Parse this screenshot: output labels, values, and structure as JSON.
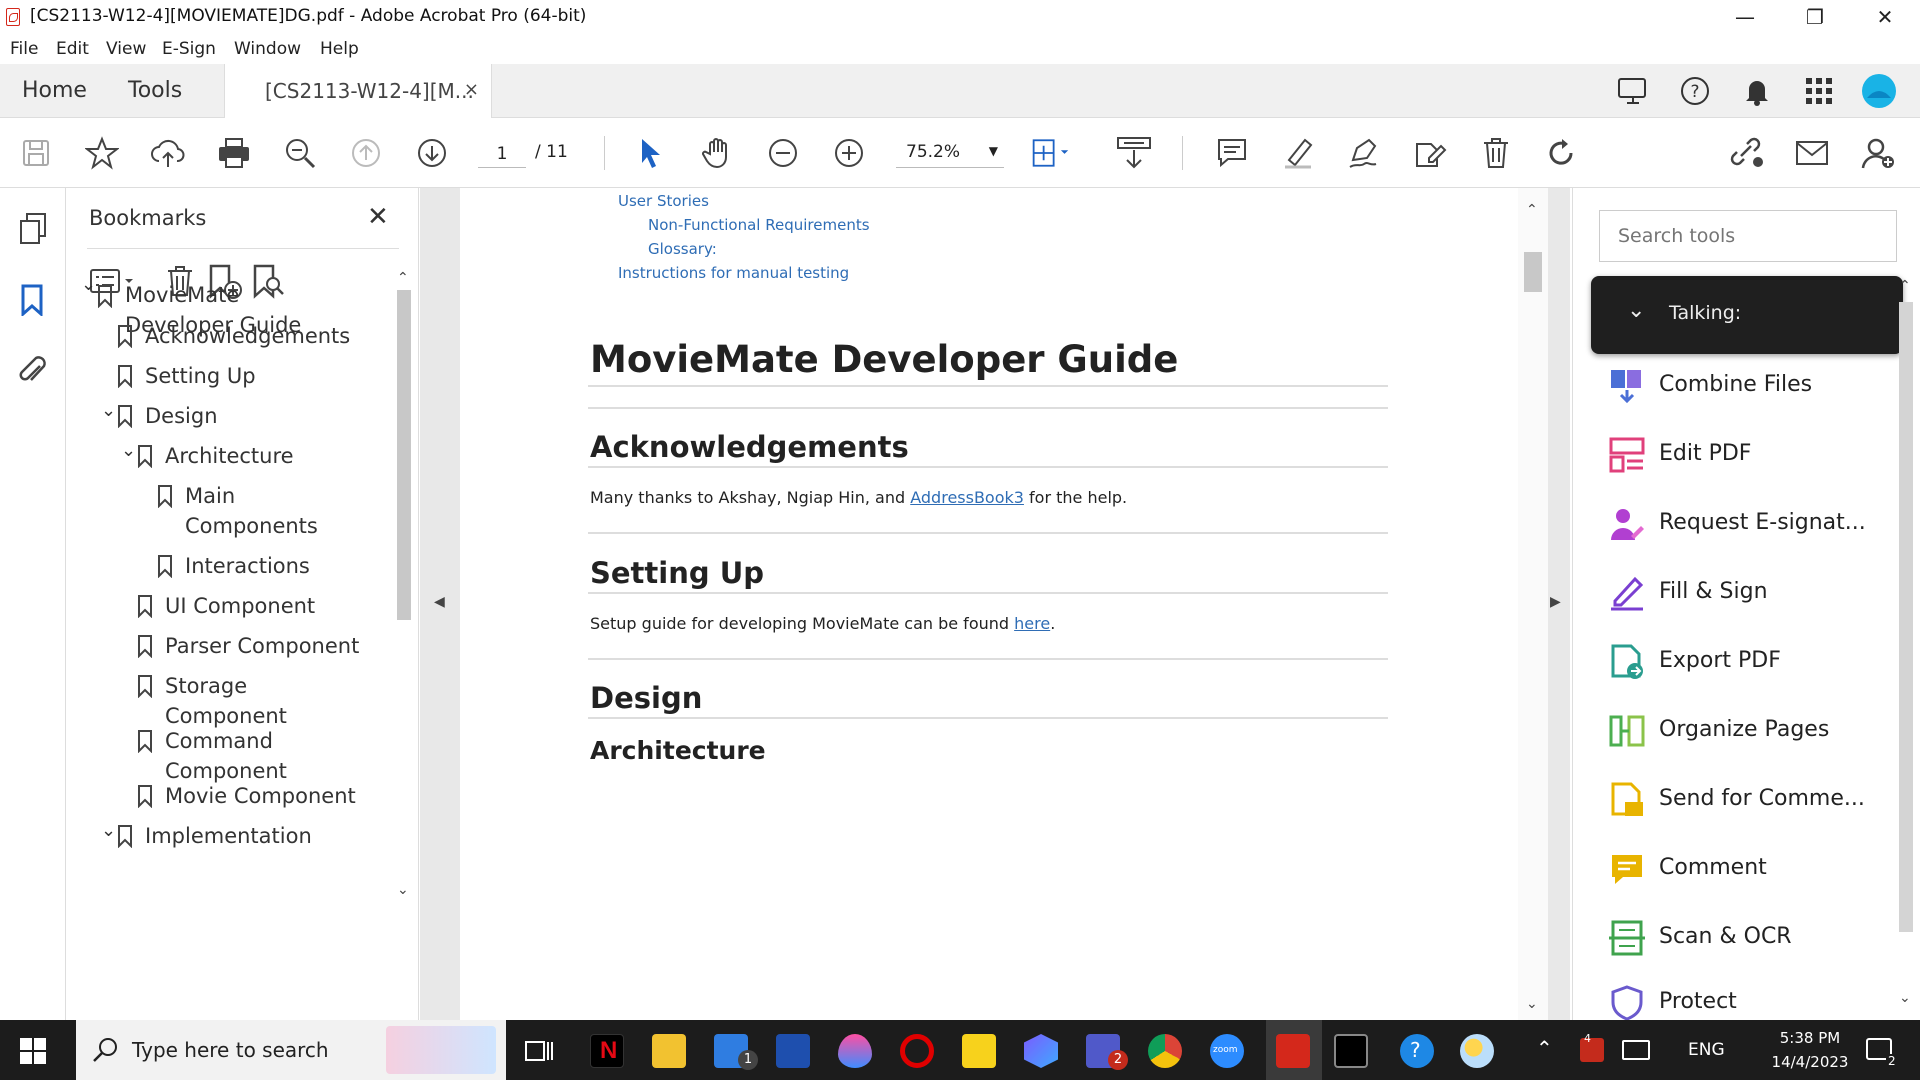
{
  "window": {
    "title": "[CS2113-W12-4][MOVIEMATE]DG.pdf - Adobe Acrobat Pro (64-bit)"
  },
  "menu": [
    "File",
    "Edit",
    "View",
    "E-Sign",
    "Window",
    "Help"
  ],
  "tabs": {
    "home": "Home",
    "tools": "Tools",
    "document": "[CS2113-W12-4][M...",
    "close": "×"
  },
  "toolbar": {
    "page_current": "1",
    "page_total": "/ 11",
    "zoom": "75.2%"
  },
  "bookmarks": {
    "title": "Bookmarks",
    "items": [
      {
        "label": "MovieMate Developer Guide"
      },
      {
        "label": "Acknowledgements"
      },
      {
        "label": "Setting Up"
      },
      {
        "label": "Design"
      },
      {
        "label": "Architecture"
      },
      {
        "label": "Main Components"
      },
      {
        "label": "Interactions"
      },
      {
        "label": "UI Component"
      },
      {
        "label": "Parser Component"
      },
      {
        "label": "Storage Component"
      },
      {
        "label": "Command Component"
      },
      {
        "label": "Movie Component"
      },
      {
        "label": "Implementation"
      }
    ]
  },
  "document": {
    "toc": [
      "User Stories",
      "Non-Functional Requirements",
      "Glossary:",
      "Instructions for manual testing"
    ],
    "title": "MovieMate Developer Guide",
    "ack_heading": "Acknowledgements",
    "ack_text_before": "Many thanks to Akshay, Ngiap Hin, and ",
    "ack_link": "AddressBook3",
    "ack_text_after": " for the help.",
    "setup_heading": "Setting Up",
    "setup_text_before": "Setup guide for developing MovieMate can be found ",
    "setup_link": "here",
    "setup_text_after": ".",
    "design_heading": "Design",
    "arch_heading": "Architecture"
  },
  "right_panel": {
    "search_placeholder": "Search tools",
    "talking": "Talking:",
    "tools": [
      {
        "label": "Combine Files",
        "color": "#6a5acd"
      },
      {
        "label": "Edit PDF",
        "color": "#e0407b"
      },
      {
        "label": "Request E-signat...",
        "color": "#b13fd1"
      },
      {
        "label": "Fill & Sign",
        "color": "#7a3fd1"
      },
      {
        "label": "Export PDF",
        "color": "#2a9d8f"
      },
      {
        "label": "Organize Pages",
        "color": "#4caf50"
      },
      {
        "label": "Send for Comme...",
        "color": "#e8b400"
      },
      {
        "label": "Comment",
        "color": "#e8b400"
      },
      {
        "label": "Scan & OCR",
        "color": "#3fa34d"
      },
      {
        "label": "Protect",
        "color": "#6a5acd"
      }
    ]
  },
  "taskbar": {
    "search_placeholder": "Type here to search",
    "lang": "ENG",
    "time": "5:38 PM",
    "date": "14/4/2023",
    "notif_count": "2",
    "mail_badge": "1",
    "teams_badge": "2",
    "tray_badge": "4"
  }
}
